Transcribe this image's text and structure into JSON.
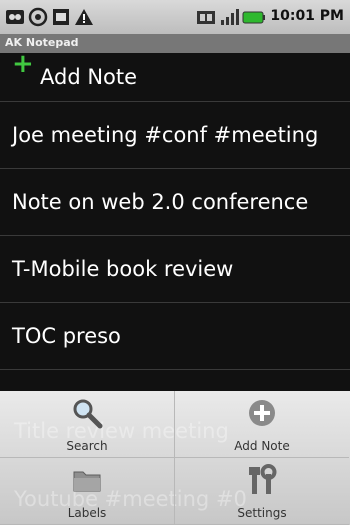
{
  "status_bar": {
    "time": "10:01 PM",
    "left_icons": [
      "voicemail-icon",
      "at-icon",
      "android-icon",
      "warning-icon"
    ],
    "right_icons": [
      "sync-icon",
      "signal-icon",
      "battery-icon"
    ]
  },
  "app": {
    "title": "AK Notepad"
  },
  "list": {
    "add_label": "Add Note",
    "notes": [
      "Joe meeting   #conf #meeting",
      "Note on web 2.0 conference",
      "T-Mobile book review",
      "TOC preso"
    ]
  },
  "background_notes": [
    "Title review meeting",
    "Youtube #meeting #0"
  ],
  "menu": {
    "items": [
      {
        "label": "Search",
        "icon": "search-icon"
      },
      {
        "label": "Add Note",
        "icon": "add-note-icon"
      },
      {
        "label": "Labels",
        "icon": "folder-icon"
      },
      {
        "label": "Settings",
        "icon": "settings-icon"
      }
    ]
  },
  "colors": {
    "accent": "#41c841",
    "list_bg": "#111111",
    "menu_bg": "#d9d9d9"
  }
}
